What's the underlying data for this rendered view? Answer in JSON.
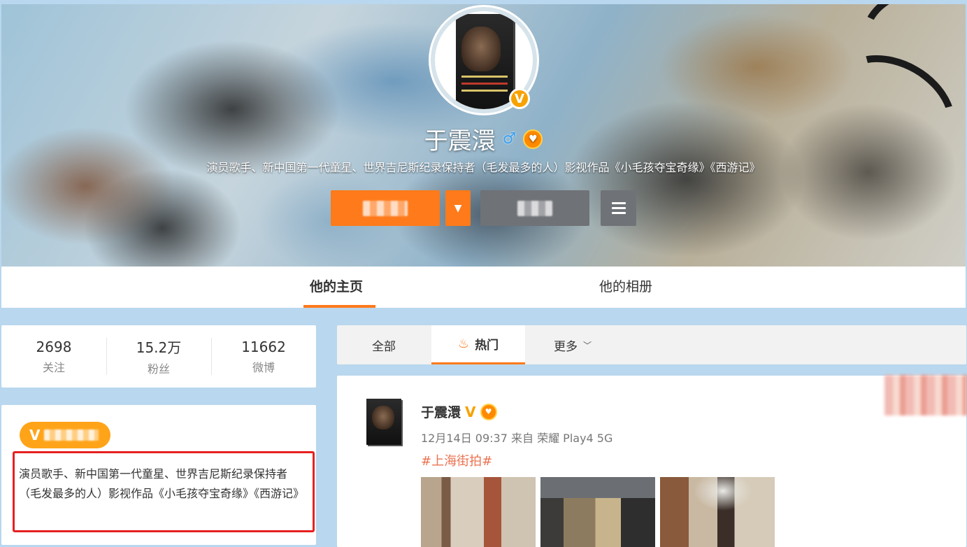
{
  "profile": {
    "name": "于震澴",
    "gender_icon": "male-icon",
    "description": "演员歌手、新中国第一代童星、世界吉尼斯纪录保持者（毛发最多的人）影视作品《小毛孩夺宝奇缘》《西游记》"
  },
  "nav": {
    "tabs": [
      {
        "label": "他的主页",
        "active": true
      },
      {
        "label": "他的相册",
        "active": false
      }
    ]
  },
  "stats": [
    {
      "value": "2698",
      "label": "关注"
    },
    {
      "value": "15.2万",
      "label": "粉丝"
    },
    {
      "value": "11662",
      "label": "微博"
    }
  ],
  "bio": {
    "badge_icon": "V",
    "text": "演员歌手、新中国第一代童星、世界吉尼斯纪录保持者（毛发最多的人）影视作品《小毛孩夺宝奇缘》《西游记》"
  },
  "feed": {
    "tabs": [
      {
        "label": "全部",
        "active": false
      },
      {
        "label": "热门",
        "active": true,
        "icon": "fire-icon"
      },
      {
        "label": "更多",
        "active": false,
        "icon": "chevron-down-icon"
      }
    ]
  },
  "post": {
    "author": "于震澴",
    "verified_icon": "V",
    "meta": "12月14日 09:37 来自 荣耀 Play4 5G",
    "tag": "#上海街拍#"
  },
  "colors": {
    "accent": "#ff7a1a",
    "verified": "#f7a200",
    "tag": "#eb7350",
    "highlight_box": "#e62020"
  }
}
